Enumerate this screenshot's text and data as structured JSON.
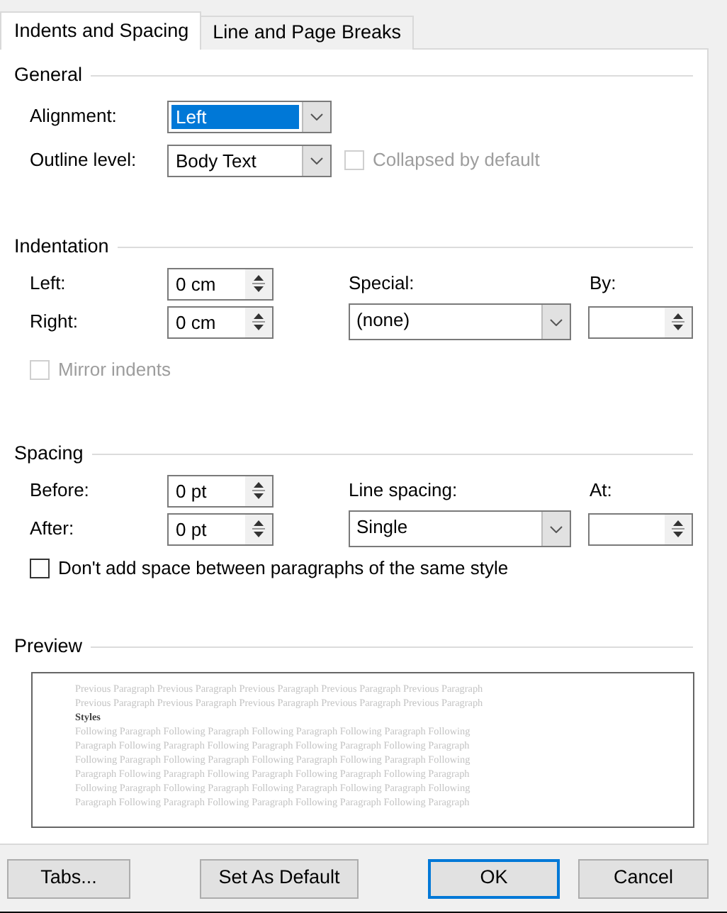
{
  "tabs": [
    {
      "label": "Indents and Spacing",
      "selected": true
    },
    {
      "label": "Line and Page Breaks",
      "selected": false
    }
  ],
  "general": {
    "title": "General",
    "alignment": {
      "label": "Alignment:",
      "value": "Left",
      "highlighted": true
    },
    "outline_level": {
      "label": "Outline level:",
      "value": "Body Text"
    },
    "collapsed": {
      "label": "Collapsed by default",
      "checked": false,
      "disabled": true
    }
  },
  "indentation": {
    "title": "Indentation",
    "left": {
      "label": "Left:",
      "value": "0 cm"
    },
    "right": {
      "label": "Right:",
      "value": "0 cm"
    },
    "special": {
      "label": "Special:",
      "value": "(none)"
    },
    "by": {
      "label": "By:"
    },
    "mirror": {
      "label": "Mirror indents",
      "checked": false,
      "disabled": true
    }
  },
  "spacing": {
    "title": "Spacing",
    "before": {
      "label": "Before:",
      "value": "0 pt"
    },
    "after": {
      "label": "After:",
      "value": "0 pt"
    },
    "line_spacing": {
      "label": "Line spacing:",
      "value": "Single"
    },
    "at": {
      "label": "At:"
    },
    "dont_add": {
      "label": "Don't add space between paragraphs of the same style",
      "checked": false,
      "disabled": false
    }
  },
  "preview": {
    "title": "Preview",
    "lines": [
      {
        "kind": "previous",
        "text": "Previous Paragraph Previous Paragraph Previous Paragraph Previous Paragraph Previous Paragraph"
      },
      {
        "kind": "previous",
        "text": "Previous Paragraph Previous Paragraph Previous Paragraph Previous Paragraph Previous Paragraph"
      },
      {
        "kind": "current",
        "text": "Styles"
      },
      {
        "kind": "following",
        "text": "Following Paragraph Following Paragraph Following Paragraph Following Paragraph Following"
      },
      {
        "kind": "following",
        "text": "Paragraph Following Paragraph Following Paragraph Following Paragraph Following Paragraph"
      },
      {
        "kind": "following",
        "text": "Following Paragraph Following Paragraph Following Paragraph Following Paragraph Following"
      },
      {
        "kind": "following",
        "text": "Paragraph Following Paragraph Following Paragraph Following Paragraph Following Paragraph"
      },
      {
        "kind": "following",
        "text": "Following Paragraph Following Paragraph Following Paragraph Following Paragraph Following"
      },
      {
        "kind": "following",
        "text": "Paragraph Following Paragraph Following Paragraph Following Paragraph Following Paragraph"
      }
    ]
  },
  "buttons": [
    {
      "label": "Tabs...",
      "default": false
    },
    {
      "label": "Set As Default",
      "default": false
    },
    {
      "label": "OK",
      "default": true
    },
    {
      "label": "Cancel",
      "default": false
    }
  ]
}
